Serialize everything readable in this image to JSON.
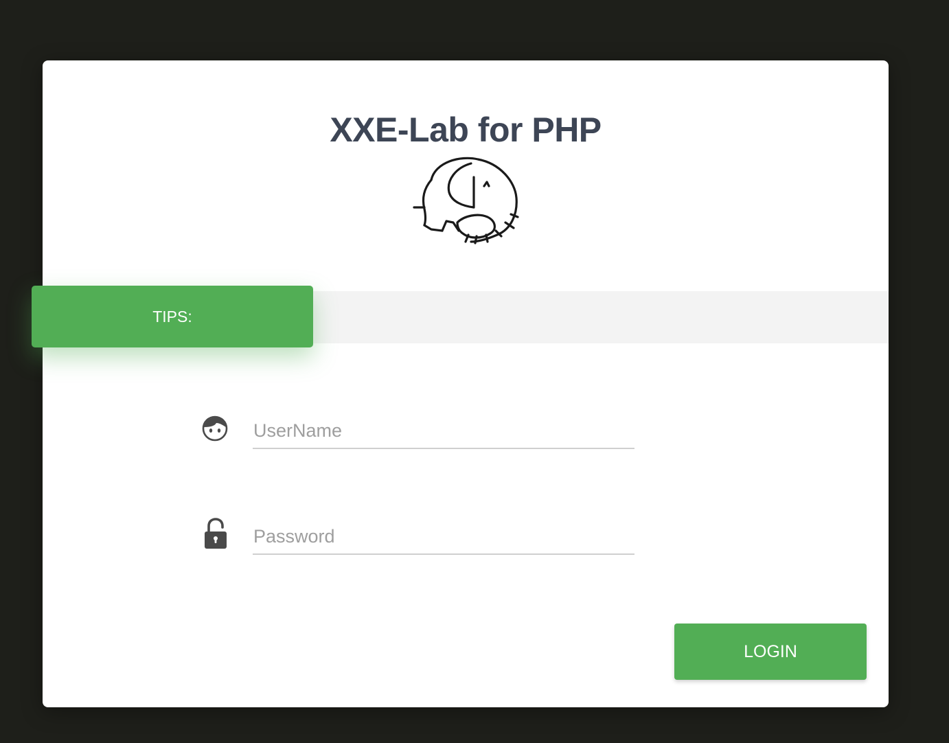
{
  "header": {
    "title": "XXE-Lab for PHP",
    "logo_icon": "php-elephant-icon"
  },
  "tips": {
    "label": "TIPS:"
  },
  "form": {
    "username": {
      "placeholder": "UserName",
      "value": "",
      "icon": "user-face-icon"
    },
    "password": {
      "placeholder": "Password",
      "value": "",
      "icon": "unlocked-padlock-icon"
    },
    "login_label": "LOGIN"
  },
  "colors": {
    "background": "#1e1f1a",
    "accent": "#52ae55",
    "title": "#3d4555",
    "strip": "#f3f3f3"
  }
}
